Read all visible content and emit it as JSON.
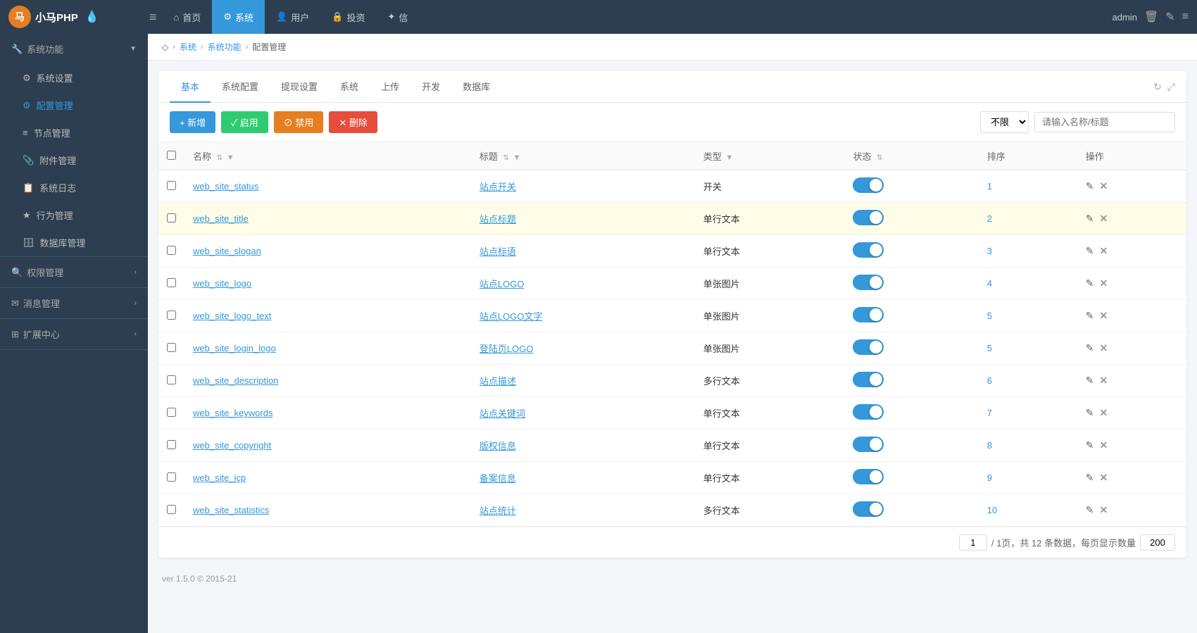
{
  "brand": {
    "name": "小马PHP",
    "icon_label": "马"
  },
  "top_nav": {
    "hamburger": "≡",
    "items": [
      {
        "label": "首页",
        "icon": "⌂",
        "active": false
      },
      {
        "label": "系统",
        "icon": "⚙",
        "active": true
      },
      {
        "label": "用户",
        "icon": "👤",
        "active": false
      },
      {
        "label": "投资",
        "icon": "🔒",
        "active": false
      },
      {
        "label": "信",
        "icon": "✦",
        "active": false
      }
    ],
    "admin_label": "admin",
    "icons": [
      "🗑",
      "✎",
      "≡"
    ]
  },
  "sidebar": {
    "groups": [
      {
        "title": "系统功能",
        "icon": "🔧",
        "expanded": true,
        "items": [
          {
            "label": "系统设置",
            "icon": "⚙",
            "active": false
          },
          {
            "label": "配置管理",
            "icon": "⚙",
            "active": true
          },
          {
            "label": "节点管理",
            "icon": "≡",
            "active": false
          },
          {
            "label": "附件管理",
            "icon": "📎",
            "active": false
          },
          {
            "label": "系统日志",
            "icon": "📋",
            "active": false
          },
          {
            "label": "行为管理",
            "icon": "★",
            "active": false
          },
          {
            "label": "数据库管理",
            "icon": "🗄",
            "active": false
          }
        ]
      },
      {
        "title": "权限管理",
        "icon": "🔍",
        "expanded": false,
        "items": []
      },
      {
        "title": "消息管理",
        "icon": "✉",
        "expanded": false,
        "items": []
      },
      {
        "title": "扩展中心",
        "icon": "⊞",
        "expanded": false,
        "items": []
      }
    ]
  },
  "breadcrumb": {
    "items": [
      {
        "label": "系统",
        "link": true
      },
      {
        "label": "系统功能",
        "link": true
      },
      {
        "label": "配置管理",
        "link": false
      }
    ]
  },
  "tabs": {
    "items": [
      {
        "label": "基本"
      },
      {
        "label": "系统配置"
      },
      {
        "label": "提现设置"
      },
      {
        "label": "系统"
      },
      {
        "label": "上传"
      },
      {
        "label": "开发"
      },
      {
        "label": "数据库"
      }
    ],
    "active_index": 0
  },
  "toolbar": {
    "add_label": "+ 新增",
    "enable_label": "✓ 启用",
    "disable_label": "⊘ 禁用",
    "delete_label": "✕ 删除",
    "filter_options": [
      "不限"
    ],
    "filter_selected": "不限",
    "search_placeholder": "请输入名称/标题"
  },
  "table": {
    "headers": [
      {
        "label": ""
      },
      {
        "label": "名称",
        "sortable": true,
        "filterable": true
      },
      {
        "label": "标题",
        "sortable": true,
        "filterable": true
      },
      {
        "label": "类型",
        "filterable": true
      },
      {
        "label": "状态",
        "sortable": true
      },
      {
        "label": "排序"
      },
      {
        "label": "操作"
      }
    ],
    "rows": [
      {
        "name": "web_site_status",
        "title": "站点开关",
        "type": "开关",
        "status": true,
        "order": "1",
        "highlighted": false
      },
      {
        "name": "web_site_title",
        "title": "站点标题",
        "type": "单行文本",
        "status": true,
        "order": "2",
        "highlighted": true
      },
      {
        "name": "web_site_slogan",
        "title": "站点标语",
        "type": "单行文本",
        "status": true,
        "order": "3",
        "highlighted": false
      },
      {
        "name": "web_site_logo",
        "title": "站点LOGO",
        "type": "单张图片",
        "status": true,
        "order": "4",
        "highlighted": false
      },
      {
        "name": "web_site_logo_text",
        "title": "站点LOGO文字",
        "type": "单张图片",
        "status": true,
        "order": "5",
        "highlighted": false
      },
      {
        "name": "web_site_login_logo",
        "title": "登陆页LOGO",
        "type": "单张图片",
        "status": true,
        "order": "5",
        "highlighted": false
      },
      {
        "name": "web_site_description",
        "title": "站点描述",
        "type": "多行文本",
        "status": true,
        "order": "6",
        "highlighted": false
      },
      {
        "name": "web_site_keywords",
        "title": "站点关键词",
        "type": "单行文本",
        "status": true,
        "order": "7",
        "highlighted": false
      },
      {
        "name": "web_site_copyright",
        "title": "版权信息",
        "type": "单行文本",
        "status": true,
        "order": "8",
        "highlighted": false
      },
      {
        "name": "web_site_icp",
        "title": "备案信息",
        "type": "单行文本",
        "status": true,
        "order": "9",
        "highlighted": false
      },
      {
        "name": "web_site_statistics",
        "title": "站点统计",
        "type": "多行文本",
        "status": true,
        "order": "10",
        "highlighted": false
      }
    ]
  },
  "pagination": {
    "current_page": "1",
    "total_pages": "1",
    "total_records": "12",
    "page_size": "200",
    "info_template": "/ 1页，共 12 条数据，每页显示数量"
  },
  "footer": {
    "version": "ver 1.5.0 © 2015-21"
  }
}
